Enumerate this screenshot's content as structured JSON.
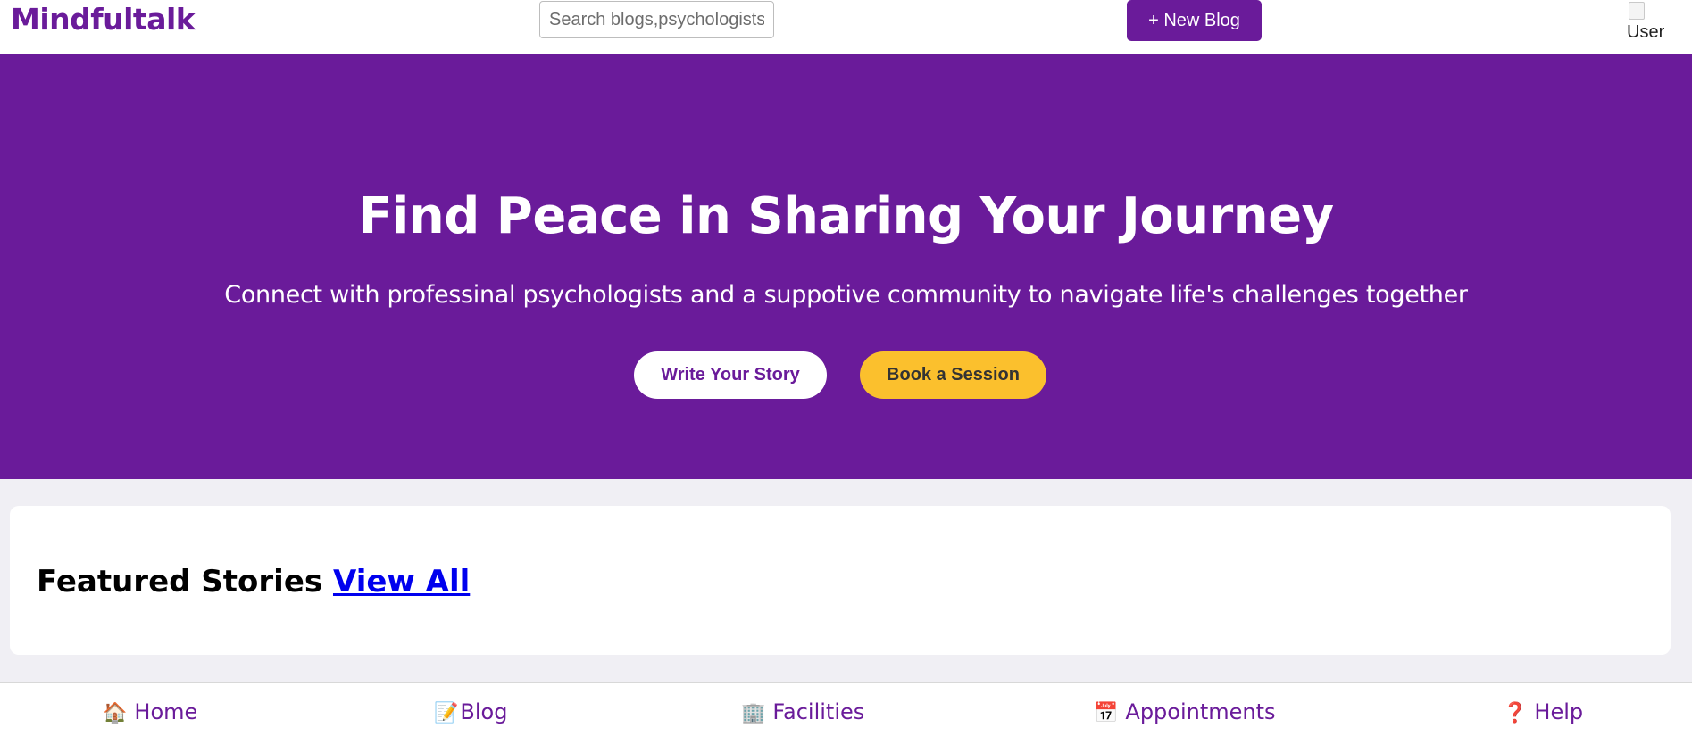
{
  "header": {
    "logo": "Mindfultalk",
    "search_placeholder": "Search blogs,psychologists",
    "new_blog_label": "+ New Blog",
    "avatar_alt": "User"
  },
  "hero": {
    "title": "Find Peace in Sharing Your Journey",
    "subtitle": "Connect with professinal psychologists and a suppotive community to navigate life's challenges together",
    "write_button": "Write Your Story",
    "book_button": "Book a Session"
  },
  "featured": {
    "title": "Featured Stories",
    "view_all": "View All"
  },
  "bottom_nav": [
    {
      "icon": "🏠",
      "icon_name": "home-icon",
      "label": "Home"
    },
    {
      "icon": "📝",
      "icon_name": "memo-icon",
      "label": "Blog"
    },
    {
      "icon": "🏢",
      "icon_name": "building-icon",
      "label": "Facilities"
    },
    {
      "icon": "📅",
      "icon_name": "calendar-icon",
      "label": "Appointments"
    },
    {
      "icon": "❓",
      "icon_name": "question-icon",
      "label": "Help"
    }
  ],
  "colors": {
    "brand": "#6a1b9a",
    "accent": "#fbc02d",
    "background": "#f0eff4",
    "link": "#0000ee"
  }
}
